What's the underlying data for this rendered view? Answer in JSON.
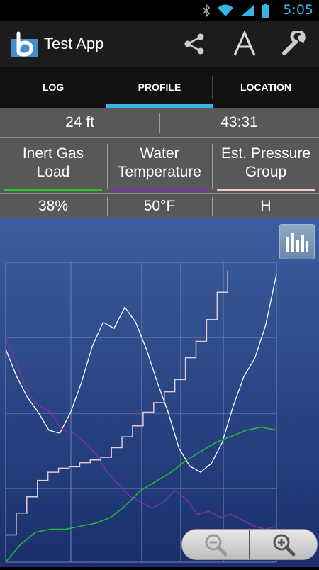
{
  "status": {
    "time": "5:05"
  },
  "app": {
    "title": "Test App"
  },
  "toolbar": {
    "icons": [
      "share-icon",
      "font-icon",
      "wrench-icon"
    ]
  },
  "tabs": [
    {
      "label": "LOG",
      "selected": false
    },
    {
      "label": "PROFILE",
      "selected": true
    },
    {
      "label": "LOCATION",
      "selected": false
    }
  ],
  "stats": {
    "depth": "24 ft",
    "time": "43:31",
    "headers": [
      {
        "label_line1": "Inert Gas",
        "label_line2": "Load",
        "color": "#22cc22"
      },
      {
        "label_line1": "Water",
        "label_line2": "Temperature",
        "color": "#7a2fb0"
      },
      {
        "label_line1": "Est. Pressure",
        "label_line2": "Group",
        "color": "#f0c8c8"
      }
    ],
    "values": [
      "38%",
      "50°F",
      "H"
    ]
  },
  "colors": {
    "accent": "#33b5e5",
    "chart_top": "#3a5a9a",
    "chart_bottom": "#1c3270"
  },
  "chart_data": {
    "type": "line",
    "series": [
      {
        "values": [
          0.71,
          0.62,
          0.55,
          0.5,
          0.44,
          0.43,
          0.5,
          0.6,
          0.72,
          0.8,
          0.78,
          0.85,
          0.8,
          0.71,
          0.6,
          0.5,
          0.38,
          0.32,
          0.3,
          0.33,
          0.4,
          0.52,
          0.62,
          0.68,
          0.79,
          0.96
        ]
      },
      {
        "values": [
          0.75,
          0.66,
          0.56,
          0.52,
          0.5,
          0.44,
          0.43,
          0.4,
          0.36,
          0.3,
          0.26,
          0.22,
          0.2,
          0.18,
          0.2,
          0.24,
          0.21,
          0.16,
          0.17,
          0.15,
          0.16,
          0.14,
          0.12,
          0.11,
          0.12
        ]
      },
      {
        "values": [
          0.2,
          0.36,
          0.48,
          0.6,
          0.66,
          0.69,
          0.7,
          0.73,
          0.75,
          0.77,
          0.84,
          0.92,
          1.0,
          1.1,
          1.17,
          1.25,
          1.34,
          1.5,
          1.62,
          1.78,
          1.98,
          2.14
        ]
      },
      {
        "values": [
          0.0,
          0.06,
          0.1,
          0.11,
          0.11,
          0.12,
          0.13,
          0.15,
          0.19,
          0.24,
          0.27,
          0.3,
          0.34,
          0.37,
          0.4,
          0.42,
          0.44,
          0.45,
          0.44
        ]
      }
    ]
  }
}
